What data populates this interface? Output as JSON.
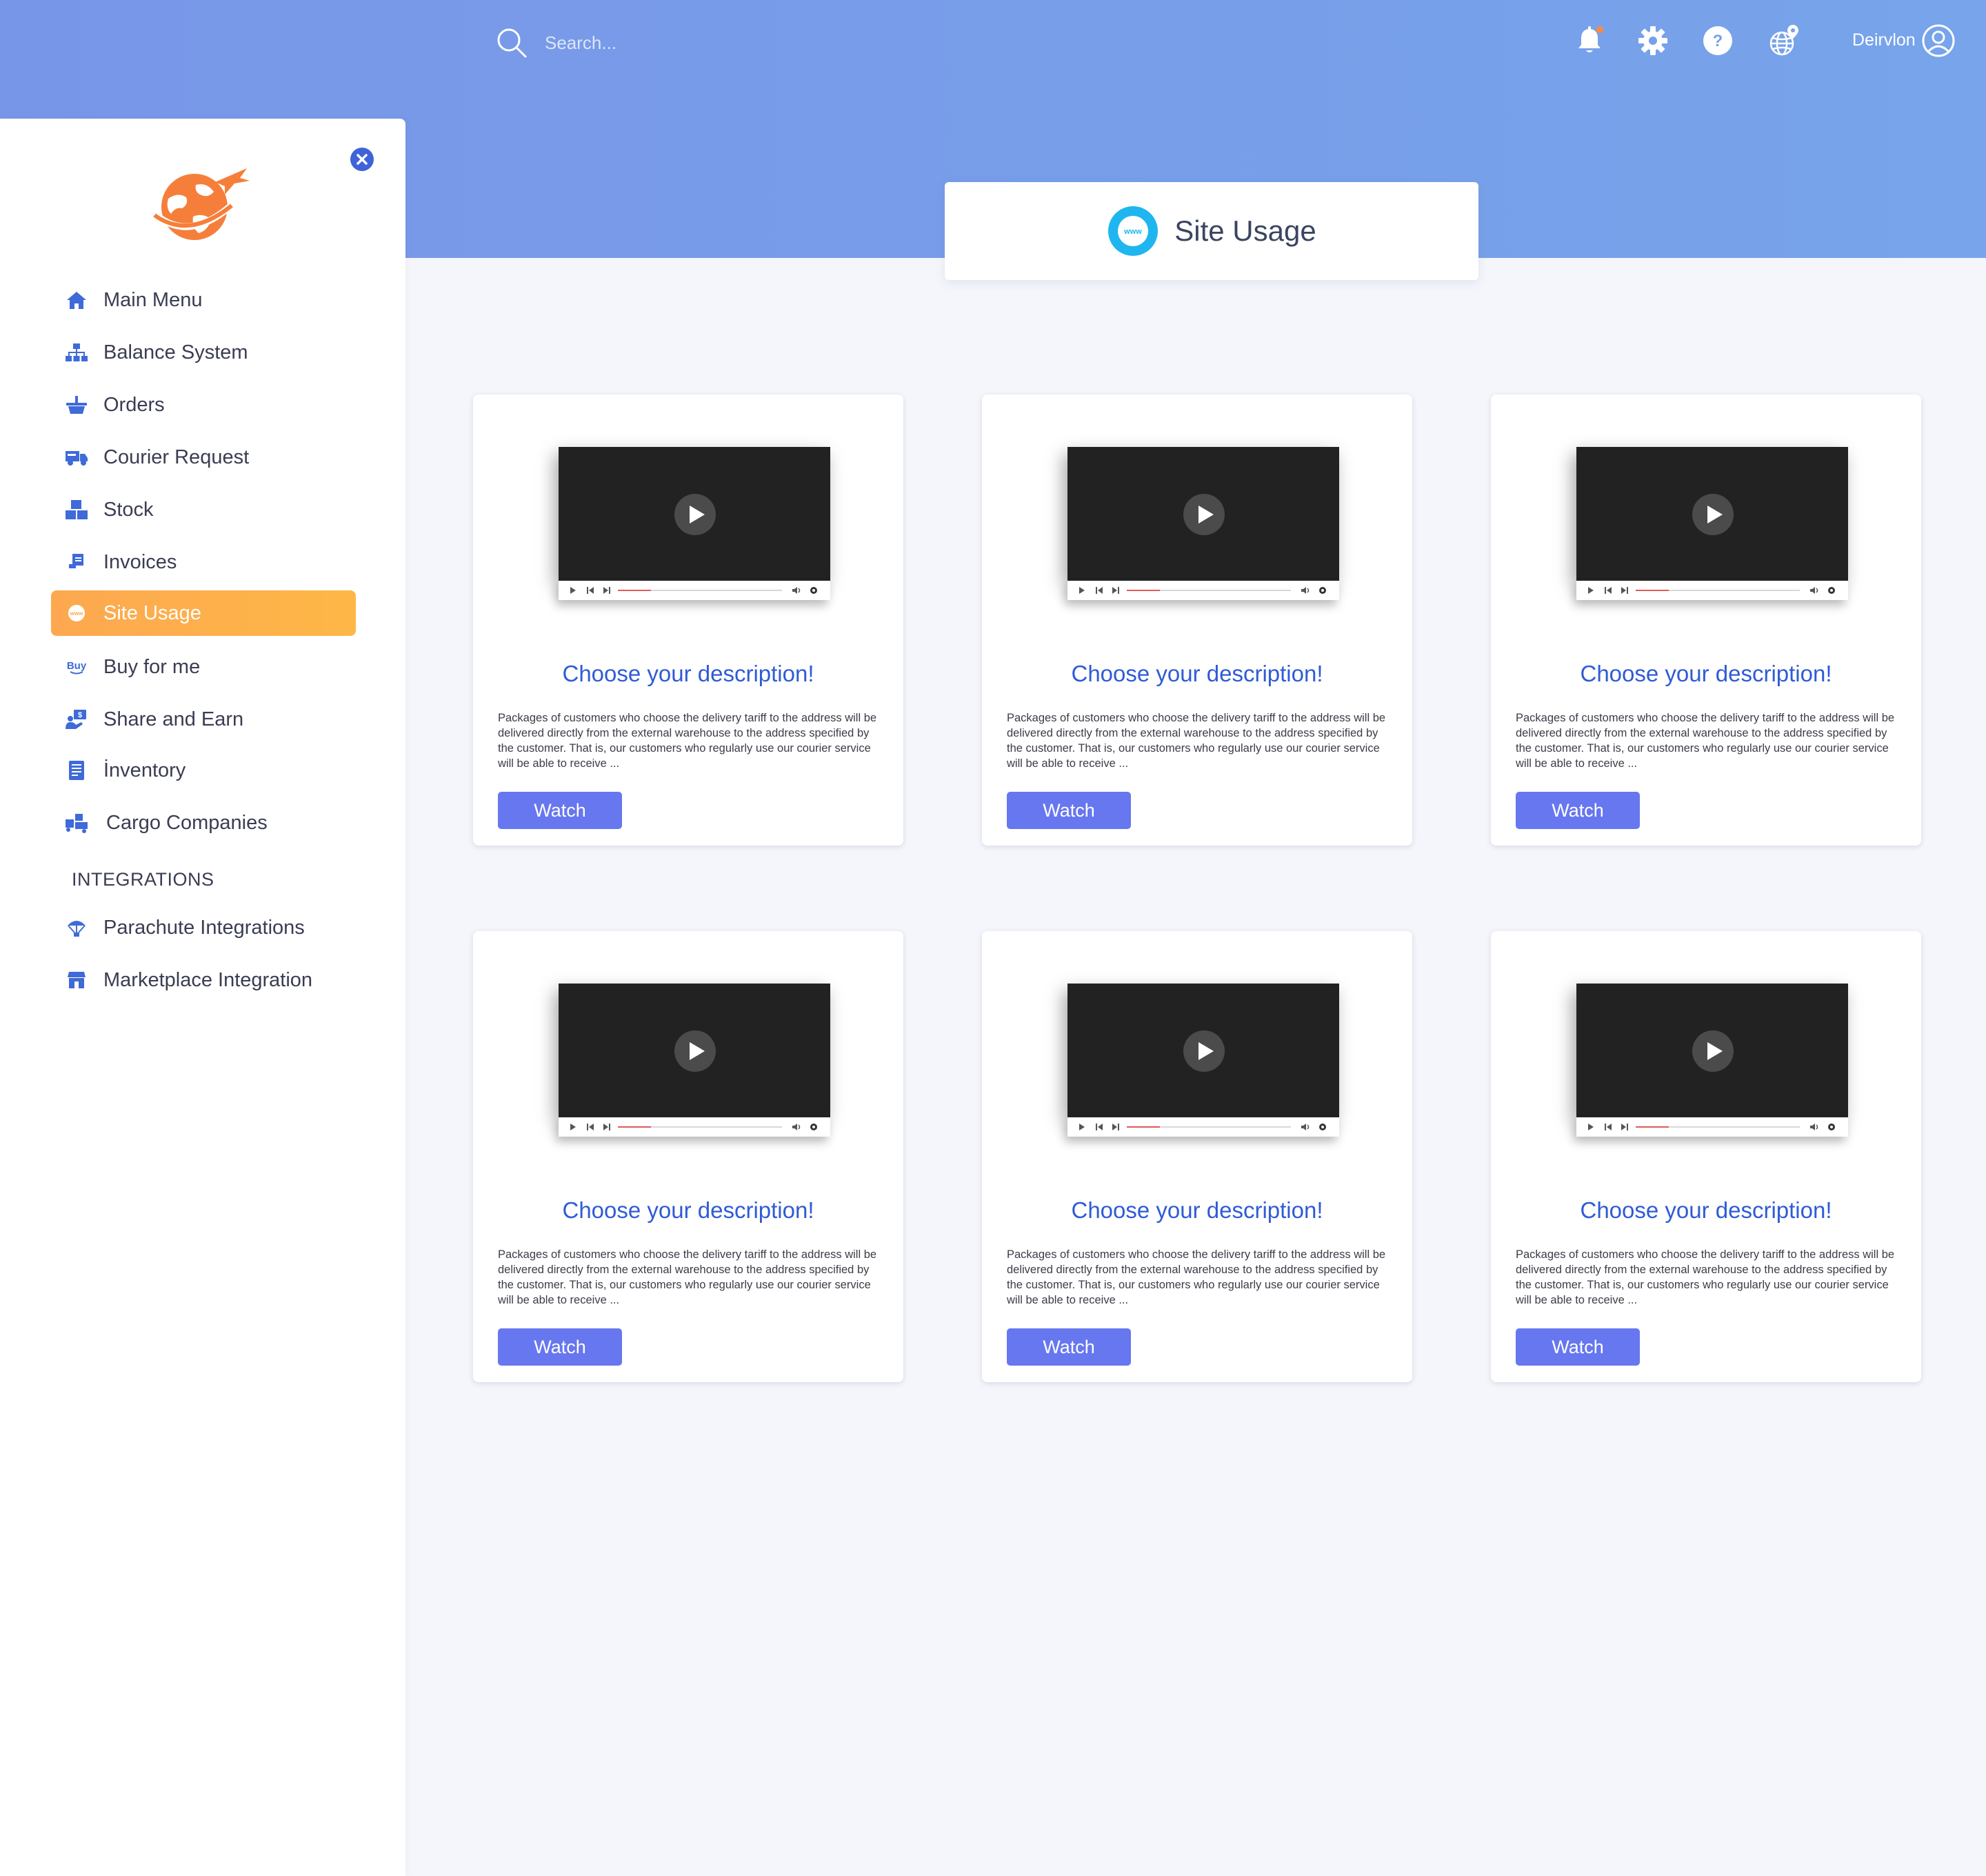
{
  "header": {
    "search_placeholder": "Search...",
    "user_name": "Deirvlon",
    "icons": [
      "bell-icon",
      "gear-icon",
      "help-icon",
      "globe-icon",
      "user-avatar-icon"
    ],
    "notification_dot_color": "#ff8a3d"
  },
  "sidebar": {
    "items": [
      {
        "label": "Main Menu",
        "icon": "home-icon"
      },
      {
        "label": "Balance System",
        "icon": "sitemap-icon"
      },
      {
        "label": "Orders",
        "icon": "basket-icon"
      },
      {
        "label": "Courier Request",
        "icon": "truck-icon"
      },
      {
        "label": "Stock",
        "icon": "boxes-icon"
      },
      {
        "label": "Invoices",
        "icon": "receipt-icon"
      },
      {
        "label": "Site Usage",
        "icon": "www-icon",
        "active": true
      },
      {
        "label": "Buy for me",
        "icon": "buy-icon"
      },
      {
        "label": "Share and Earn",
        "icon": "share-earn-icon"
      },
      {
        "label": "İnventory",
        "icon": "inventory-icon"
      },
      {
        "label": "Cargo Companies",
        "icon": "cargo-icon"
      }
    ],
    "section_label": "INTEGRATIONS",
    "integration_items": [
      {
        "label": "Parachute Integrations",
        "icon": "parachute-icon"
      },
      {
        "label": "Marketplace Integration",
        "icon": "store-icon"
      }
    ],
    "active_color": "#fea94f",
    "icon_color": "#3f6ad8"
  },
  "page": {
    "title": "Site Usage",
    "title_icon_color": "#1fb6f0"
  },
  "cards": [
    {
      "heading": "Choose your description!",
      "description": "Packages of customers who choose the delivery tariff to the address will be delivered directly from the external warehouse to the address specified by the customer. That is, our customers who regularly use our courier service will be able to receive ...",
      "button": "Watch"
    },
    {
      "heading": "Choose your description!",
      "description": "Packages of customers who choose the delivery tariff to the address will be delivered directly from the external warehouse to the address specified by the customer. That is, our customers who regularly use our courier service will be able to receive ...",
      "button": "Watch"
    },
    {
      "heading": "Choose your description!",
      "description": "Packages of customers who choose the delivery tariff to the address will be delivered directly from the external warehouse to the address specified by the customer. That is, our customers who regularly use our courier service will be able to receive ...",
      "button": "Watch"
    },
    {
      "heading": "Choose your description!",
      "description": "Packages of customers who choose the delivery tariff to the address will be delivered directly from the external warehouse to the address specified by the customer. That is, our customers who regularly use our courier service will be able to receive ...",
      "button": "Watch"
    },
    {
      "heading": "Choose your description!",
      "description": "Packages of customers who choose the delivery tariff to the address will be delivered directly from the external warehouse to the address specified by the customer. That is, our customers who regularly use our courier service will be able to receive ...",
      "button": "Watch"
    },
    {
      "heading": "Choose your description!",
      "description": "Packages of customers who choose the delivery tariff to the address will be delivered directly from the external warehouse to the address specified by the customer. That is, our customers who regularly use our courier service will be able to receive ...",
      "button": "Watch"
    }
  ],
  "video_progress": 0.2,
  "accent_color": "#6777ef",
  "heading_color": "#2f5bd6"
}
